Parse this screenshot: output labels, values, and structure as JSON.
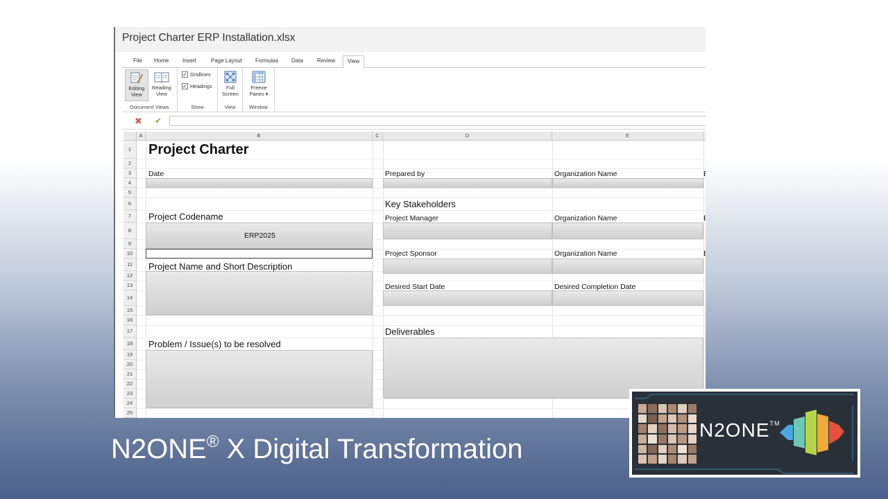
{
  "window": {
    "title": "Project Charter ERP Installation.xlsx"
  },
  "tabs": [
    "File",
    "Home",
    "Insert",
    "Page Layout",
    "Formulas",
    "Data",
    "Review",
    "View"
  ],
  "active_tab": "View",
  "ribbon": {
    "editing_view": [
      "Editing",
      "View"
    ],
    "reading_view": [
      "Reading",
      "View"
    ],
    "document_views": "Document Views",
    "gridlines": "Gridlines",
    "headings": "Headings",
    "show": "Show",
    "full_screen": [
      "Full",
      "Screen"
    ],
    "view": "View",
    "freeze_panes": [
      "Freeze",
      "Panes ▾"
    ],
    "window": "Window"
  },
  "columns": [
    "A",
    "B",
    "C",
    "D",
    "E"
  ],
  "rows": [
    "1",
    "2",
    "3",
    "4",
    "5",
    "6",
    "7",
    "8",
    "9",
    "10",
    "11",
    "12",
    "13",
    "14",
    "15",
    "16",
    "17",
    "18",
    "19",
    "20",
    "21",
    "22",
    "23",
    "24",
    "25"
  ],
  "sheet": {
    "title": "Project Charter",
    "date": "Date",
    "prepared_by": "Prepared by",
    "organization_name_1": "Organization Name",
    "key_stakeholders": "Key Stakeholders",
    "project_codename": "Project Codename",
    "project_manager": "Project Manager",
    "organization_name_2": "Organization Name",
    "codename_value": "ERP2025",
    "project_sponsor": "Project Sponsor",
    "organization_name_3": "Organization Name",
    "project_name_desc": "Project Name and Short Description",
    "desired_start": "Desired Start Date",
    "desired_completion": "Desired Completion Date",
    "deliverables": "Deliverables",
    "problem": "Problem / Issue(s) to be resolved",
    "clip_e": "E"
  },
  "caption": {
    "brand": "N2ONE",
    "reg": "®",
    "rest": " X Digital Transformation"
  },
  "logo": {
    "text": "N2ONE",
    "tm": "TM"
  },
  "colors": {
    "accent_tab": "#ffffff",
    "logo_bg": "#2a3038"
  }
}
